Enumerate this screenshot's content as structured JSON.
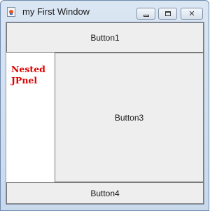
{
  "window": {
    "title": "my First Window",
    "controls": {
      "minimize": "minimize",
      "maximize": "maximize",
      "close": "✕"
    }
  },
  "buttons": {
    "north": "Button1",
    "center": "Button3",
    "south": "Button4"
  },
  "nested_panel": {
    "label_line1": "Nested",
    "label_line2": "JPnel",
    "label_color": "#e00000"
  },
  "icons": {
    "app": "java-cup-icon",
    "minimize": "minimize-icon",
    "maximize": "maximize-icon",
    "close": "close-icon"
  }
}
